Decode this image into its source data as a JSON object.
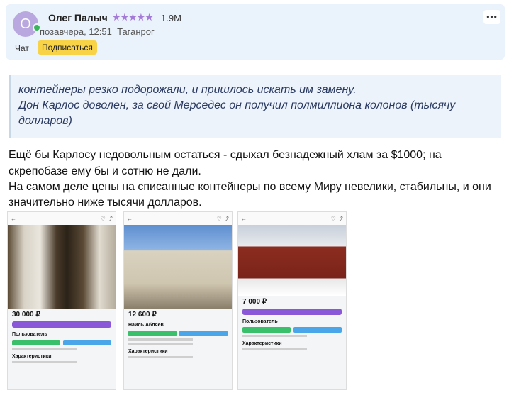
{
  "post": {
    "author": "Олег Палыч",
    "avatar_letter": "О",
    "rating": "1.9M",
    "stars": "★★★★★",
    "time": "позавчера, 12:51",
    "location": "Таганрог",
    "chat_label": "Чат",
    "subscribe_label": "Подписаться",
    "more_label": "•••"
  },
  "quote": {
    "lines": [
      "контейнеры резко подорожали, и пришлось искать им замену.",
      "Дон Карлос доволен, за свой Мерседес он получил полмиллиона колонов (тысячу",
      "долларов)"
    ]
  },
  "body": {
    "paragraphs": [
      "Ещё бы Карлосу недовольным остаться - сдыхал безнадежный хлам за $1000; на",
      "скрепобазе ему бы и сотню не дали.",
      "На самом деле цены на списанные контейнеры по всему Миру невелики, стабильны, и они",
      "значительно ниже тысячи долларов."
    ]
  },
  "screens": [
    {
      "price": "30 000 ₽",
      "section1": "Пользователь",
      "section2": "Характеристики"
    },
    {
      "price": "12 600 ₽",
      "section1": "Наиль Абляев",
      "section2": "Характеристики"
    },
    {
      "price": "7 000 ₽",
      "section1": "Пользователь",
      "section2": "Характеристики"
    }
  ],
  "colors": {
    "accent": "#8a57d8",
    "green": "#3ac06a",
    "blue": "#4aa6e8",
    "subscribe": "#f8d347"
  }
}
